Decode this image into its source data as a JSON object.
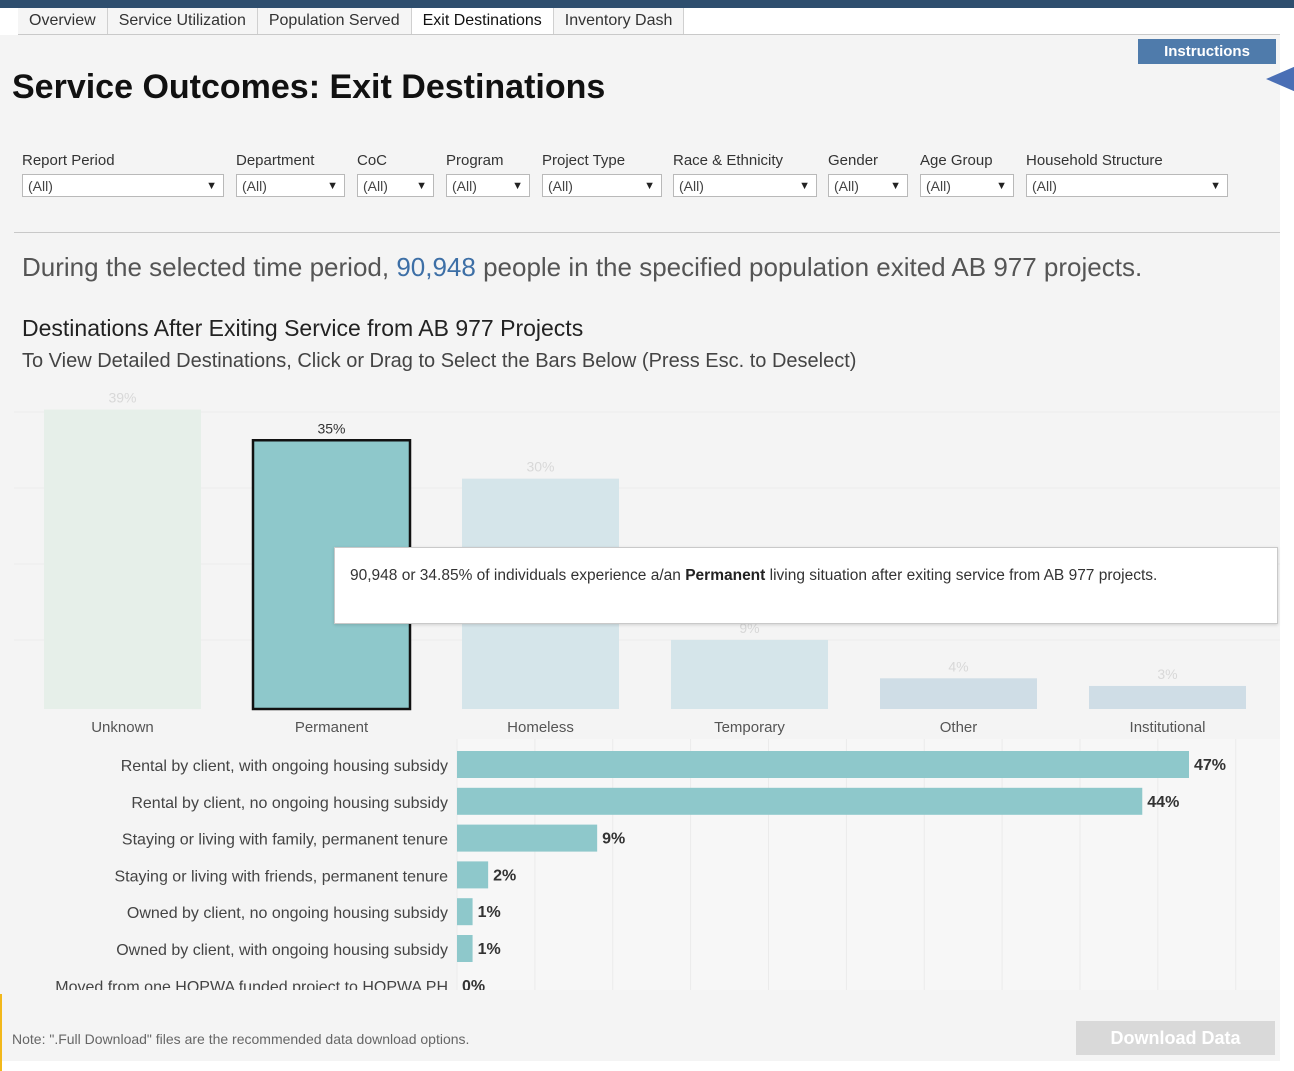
{
  "tabs": [
    {
      "label": "Overview"
    },
    {
      "label": "Service Utilization"
    },
    {
      "label": "Population Served"
    },
    {
      "label": "Exit Destinations",
      "active": true
    },
    {
      "label": "Inventory Dash"
    }
  ],
  "instructions_label": "Instructions",
  "title": "Service Outcomes: Exit Destinations",
  "filters": [
    {
      "label": "Report Period",
      "value": "(All)"
    },
    {
      "label": "Department",
      "value": "(All)"
    },
    {
      "label": "CoC",
      "value": "(All)"
    },
    {
      "label": "Program",
      "value": "(All)"
    },
    {
      "label": "Project Type",
      "value": "(All)"
    },
    {
      "label": "Race & Ethnicity",
      "value": "(All)"
    },
    {
      "label": "Gender",
      "value": "(All)"
    },
    {
      "label": "Age Group",
      "value": "(All)"
    },
    {
      "label": "Household Structure",
      "value": "(All)"
    }
  ],
  "summary": {
    "prefix": "During the selected time period, ",
    "count": "90,948",
    "suffix": " people in the specified population exited AB 977 projects."
  },
  "chart_heading": "Destinations After Exiting Service from AB 977 Projects",
  "chart_subheading": "To View Detailed Destinations, Click or Drag to Select the Bars Below (Press Esc. to Deselect)",
  "tooltip": {
    "part1": "90,948 or 34.85% of individuals experience a/an ",
    "bold": "Permanent",
    "part2": " living situation after exiting service from AB 977 projects."
  },
  "chart_data": [
    {
      "type": "bar",
      "categories": [
        "Unknown",
        "Permanent",
        "Homeless",
        "Temporary",
        "Other",
        "Institutional"
      ],
      "values": [
        39,
        35,
        30,
        9,
        4,
        3
      ],
      "labels": [
        "39%",
        "35%",
        "30%",
        "9%",
        "4%",
        "3%"
      ],
      "selected": "Permanent",
      "colors": {
        "Unknown": "#e6efe9",
        "Permanent": "#8ec8cb",
        "Homeless": "#d5e5ea",
        "Temporary": "#d5e5ea",
        "Other": "#cfdde6",
        "Institutional": "#cfdde6"
      },
      "ylim": [
        0,
        40
      ],
      "grid": true
    },
    {
      "type": "bar",
      "orientation": "horizontal",
      "categories": [
        "Rental by client, with ongoing housing subsidy",
        "Rental by client, no ongoing housing subsidy",
        "Staying or living with family, permanent tenure",
        "Staying or living with friends, permanent tenure",
        "Owned by client, no ongoing housing subsidy",
        "Owned by client, with ongoing housing subsidy",
        "Moved from one HOPWA funded project to HOPWA PH"
      ],
      "values": [
        47,
        44,
        9,
        2,
        1,
        1,
        0
      ],
      "labels": [
        "47%",
        "44%",
        "9%",
        "2%",
        "1%",
        "1%",
        "0%"
      ],
      "color": "#8ec8cb",
      "xlim": [
        0,
        52
      ],
      "grid": true
    }
  ],
  "note": "Note: \".Full Download\" files are the recommended data download options.",
  "download_label": "Download Data"
}
